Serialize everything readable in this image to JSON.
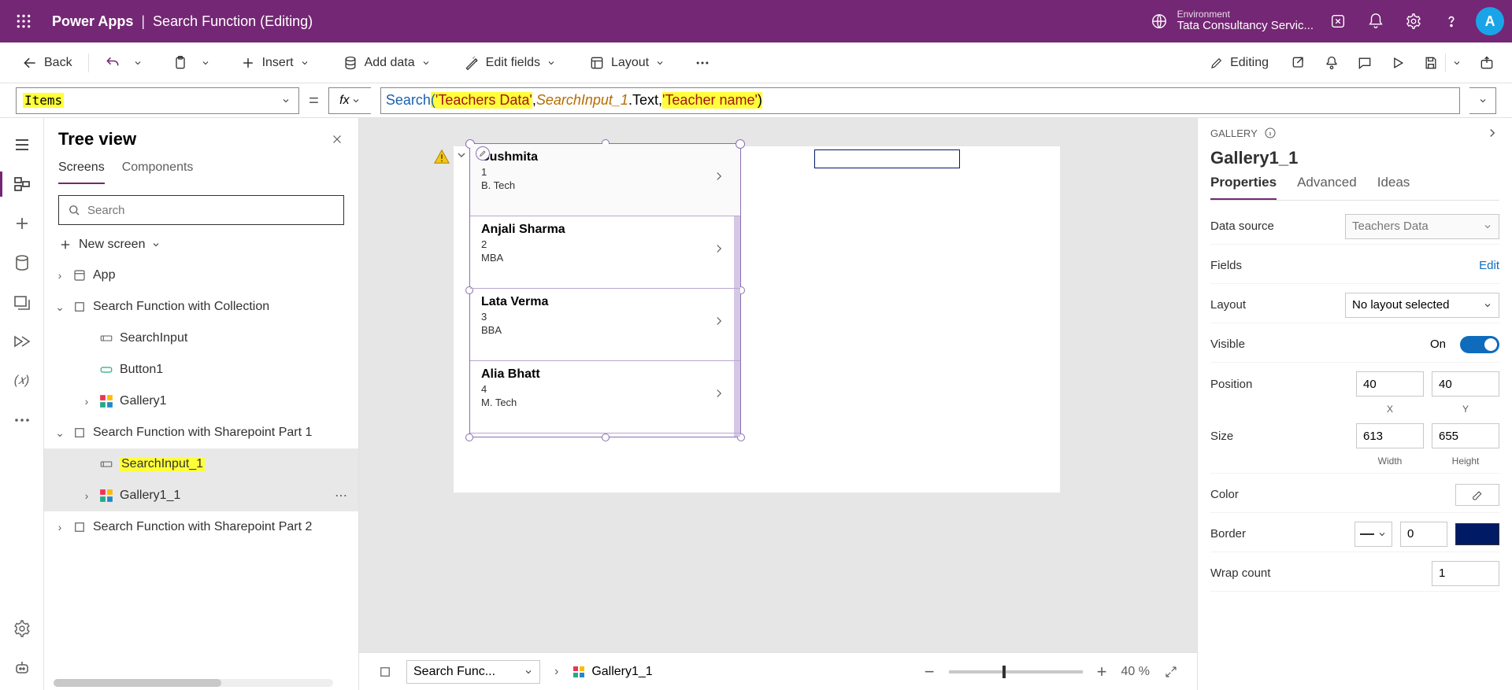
{
  "header": {
    "app": "Power Apps",
    "separator": "|",
    "subtitle": "Search Function (Editing)",
    "env_label": "Environment",
    "env_name": "Tata Consultancy Servic...",
    "avatar_initial": "A"
  },
  "toolbar": {
    "back": "Back",
    "insert": "Insert",
    "add_data": "Add data",
    "edit_fields": "Edit fields",
    "layout": "Layout",
    "editing": "Editing"
  },
  "formula_bar": {
    "property_name": "Items",
    "fx_label": "fx",
    "tokens": {
      "fn": "Search",
      "openp": "(",
      "arg1": "'Teachers Data'",
      "comma1": ", ",
      "obj": "SearchInput_1",
      "dottext": ".Text",
      "comma2": ", ",
      "arg3": "'Teacher name'",
      "closep": ")"
    }
  },
  "left_rail": {
    "variables_label": "(𝑥)"
  },
  "tree": {
    "title": "Tree view",
    "tab_screens": "Screens",
    "tab_components": "Components",
    "search_placeholder": "Search",
    "new_screen": "New screen",
    "nodes": {
      "app": "App",
      "screen1": "Search Function with Collection",
      "searchinput": "SearchInput",
      "button1": "Button1",
      "gallery1": "Gallery1",
      "screen2": "Search Function with Sharepoint Part 1",
      "searchinput1": "SearchInput_1",
      "gallery1_1": "Gallery1_1",
      "screen3": "Search Function with Sharepoint Part 2"
    }
  },
  "canvas": {
    "gallery_items": [
      {
        "title": "Sushmita",
        "line2": "1",
        "line3": "B. Tech"
      },
      {
        "title": "Anjali Sharma",
        "line2": "2",
        "line3": "MBA"
      },
      {
        "title": "Lata Verma",
        "line2": "3",
        "line3": "BBA"
      },
      {
        "title": "Alia Bhatt",
        "line2": "4",
        "line3": "M. Tech"
      }
    ],
    "footer": {
      "screen_crumb": "Search Func...",
      "gallery_crumb": "Gallery1_1",
      "zoom_value": "40",
      "zoom_unit": "%"
    }
  },
  "right_panel": {
    "gallery_caption": "GALLERY",
    "title": "Gallery1_1",
    "tab_properties": "Properties",
    "tab_advanced": "Advanced",
    "tab_ideas": "Ideas",
    "rows": {
      "data_source_label": "Data source",
      "data_source_value": "Teachers Data",
      "fields_label": "Fields",
      "fields_edit": "Edit",
      "layout_label": "Layout",
      "layout_value": "No layout selected",
      "visible_label": "Visible",
      "visible_on": "On",
      "position_label": "Position",
      "pos_x": "40",
      "pos_y": "40",
      "axis_x": "X",
      "axis_y": "Y",
      "size_label": "Size",
      "size_w": "613",
      "size_h": "655",
      "axis_w": "Width",
      "axis_h": "Height",
      "color_label": "Color",
      "border_label": "Border",
      "border_value": "0",
      "wrap_label": "Wrap count",
      "wrap_value": "1"
    }
  }
}
